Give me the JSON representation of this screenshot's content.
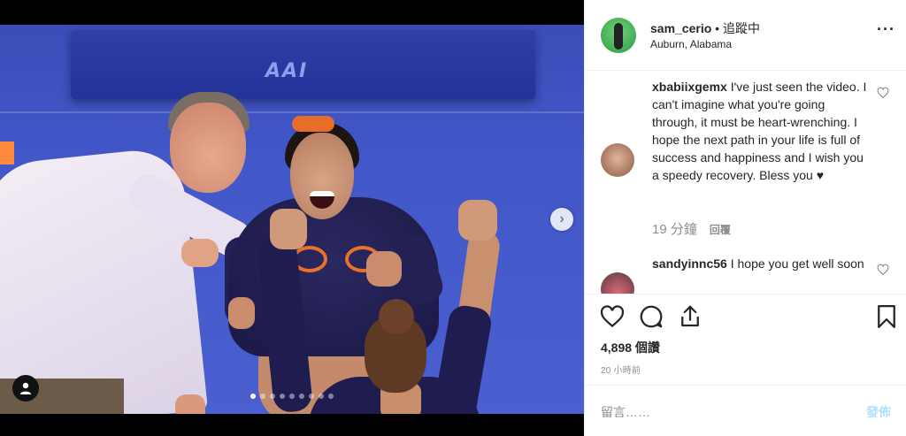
{
  "post": {
    "username": "sam_cerio",
    "separator": "•",
    "follow_status": "追蹤中",
    "location": "Auburn, Alabama",
    "likes": "4,898 個讚",
    "time_ago": "20 小時前"
  },
  "media": {
    "floor_logo": "AAI",
    "carousel_count": 9,
    "carousel_active_index": 0
  },
  "comments": [
    {
      "username": "xbabiixgemx",
      "text": "I've just seen the video. I can't imagine what you're going through, it must be heart-wrenching. I hope the next path in your life is full of success and happiness and I wish you a speedy recovery. Bless you ♥",
      "time": "19 分鐘",
      "reply_label": "回覆"
    },
    {
      "username": "sandyinnc56",
      "text": "I hope you get well soon"
    }
  ],
  "comment_box": {
    "placeholder": "留言……",
    "post_label": "發佈"
  },
  "colors": {
    "text": "#262626",
    "muted": "#8e8e8e",
    "post_disabled": "#b2dffc",
    "border": "#efefef"
  },
  "icons": {
    "more": "more-horizontal-icon",
    "like": "heart-icon",
    "comment": "comment-bubble-icon",
    "share": "share-icon",
    "save": "bookmark-icon",
    "next": "chevron-right-icon",
    "user_tag": "person-icon"
  }
}
